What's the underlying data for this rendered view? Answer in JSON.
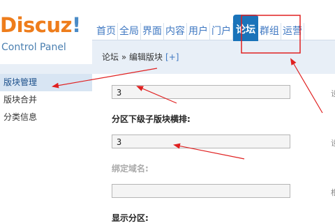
{
  "logo": {
    "name": "Discuz",
    "excl": "!",
    "subtitle": "Control Panel"
  },
  "topnav": {
    "items": [
      "首页",
      "全局",
      "界面",
      "内容",
      "用户",
      "门户",
      "论坛",
      "群组",
      "运营"
    ],
    "active_index": 6
  },
  "breadcrumb": {
    "section": "论坛",
    "separator": " » ",
    "page": "编辑版块",
    "add": "[+]"
  },
  "sidebar": {
    "items": [
      "版块管理",
      "版块合并",
      "分类信息"
    ],
    "active_index": 0
  },
  "form": {
    "field1_value": "3",
    "field1_tip": "设",
    "label2": "分区下级子版块横排:",
    "field2_value": "3",
    "field2_tip": "设",
    "label3": "绑定域名:",
    "field3_value": "",
    "field3_tip": "根",
    "label4": "显示分区:"
  },
  "colors": {
    "logo_orange": "#ee7d1c",
    "logo_blue": "#4a8bc6",
    "nav_active": "#1a73b9",
    "annotation_red": "#e02020"
  }
}
